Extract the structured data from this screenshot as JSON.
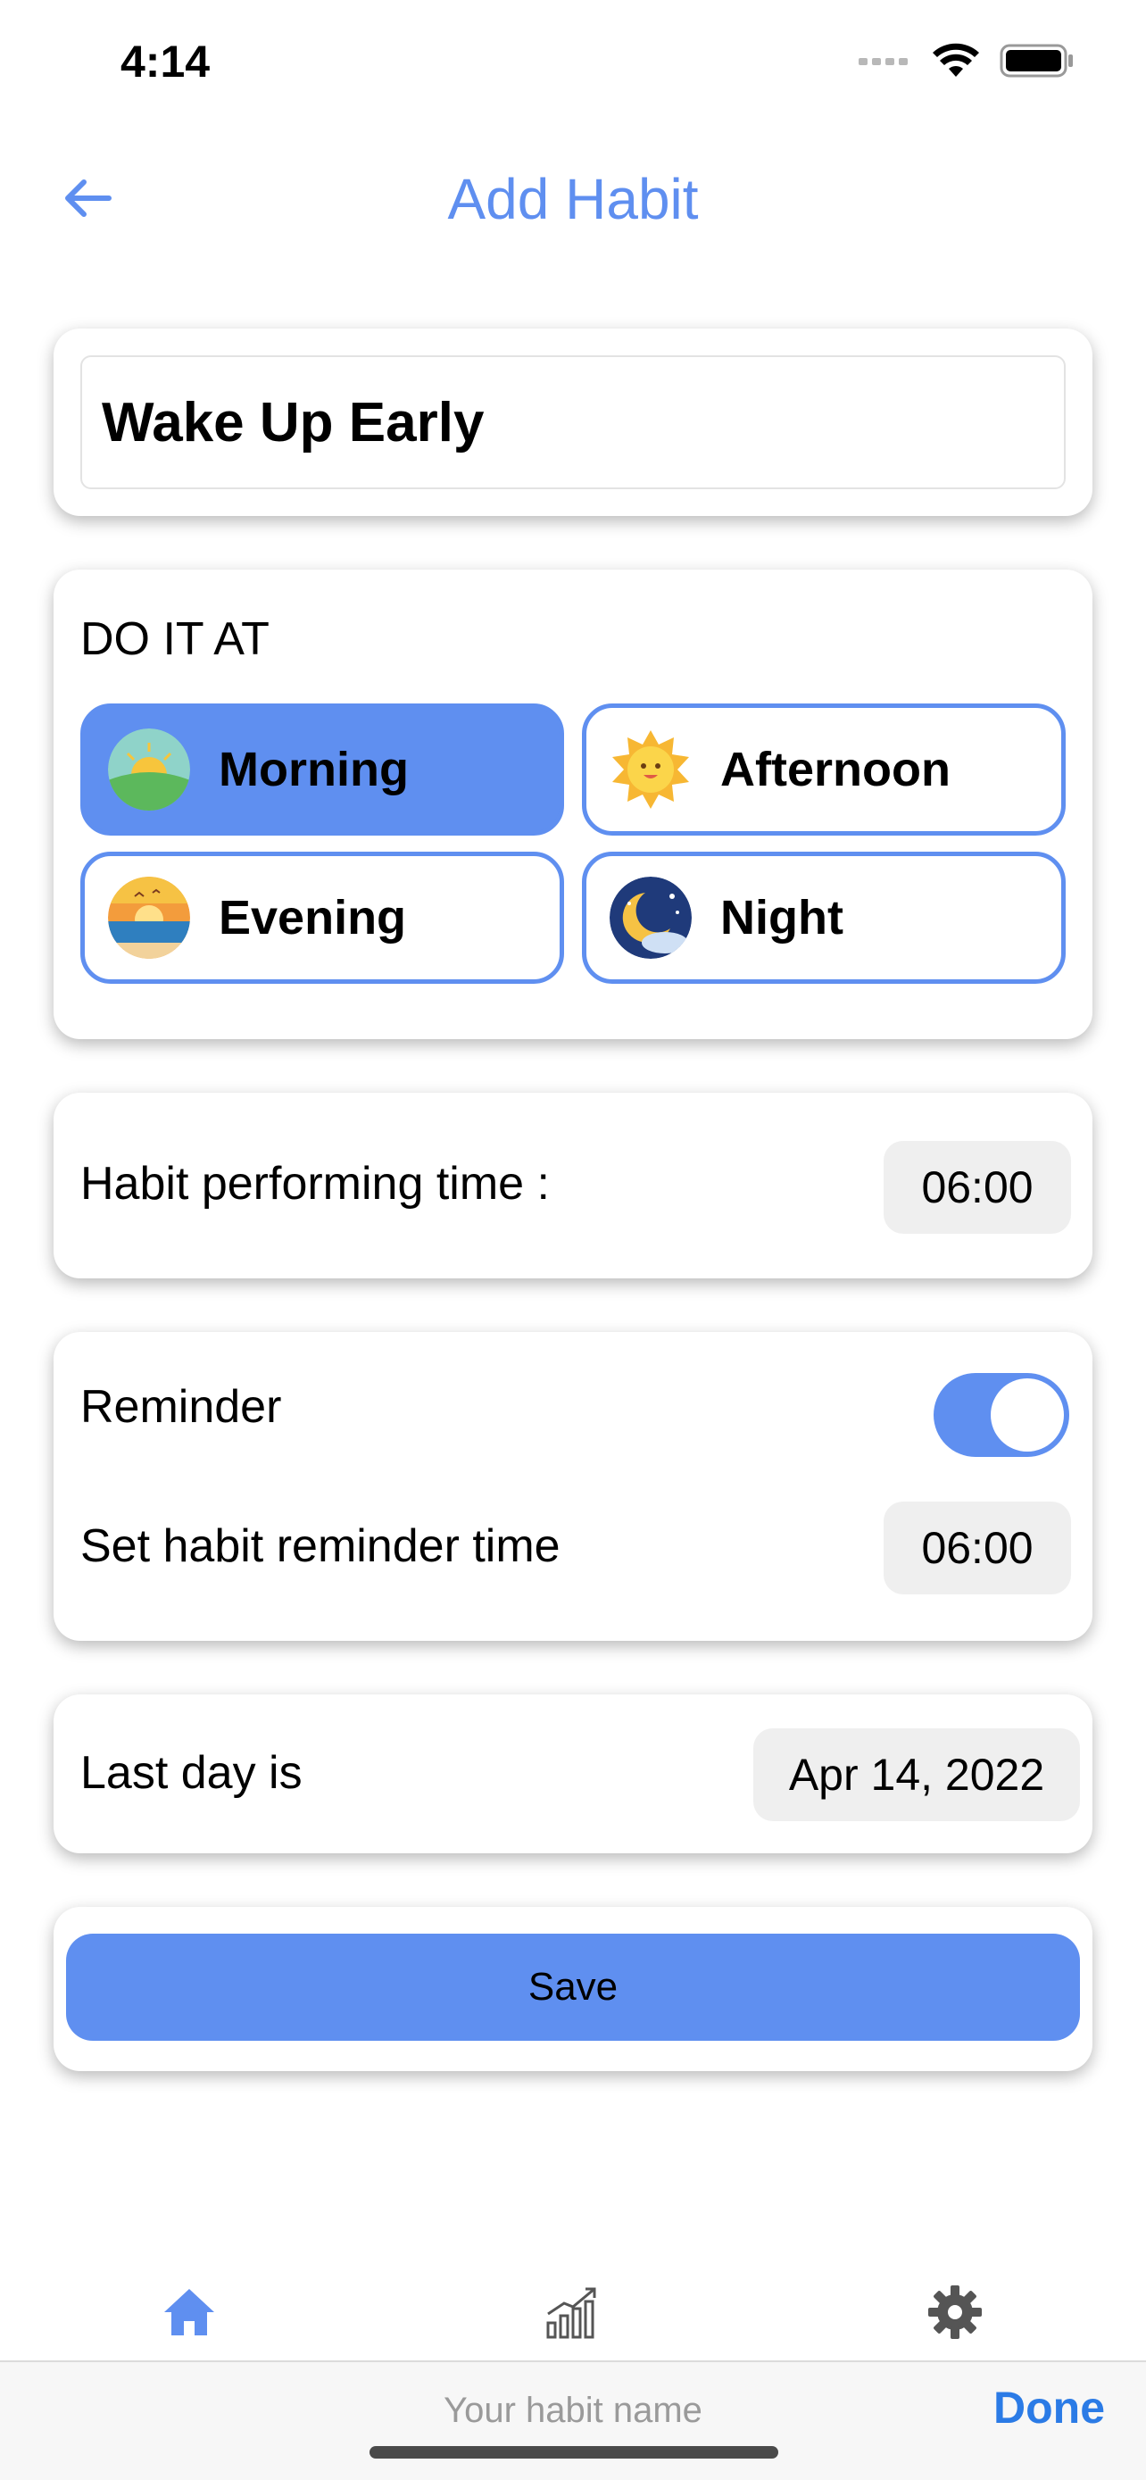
{
  "status_bar": {
    "time": "4:14"
  },
  "header": {
    "title": "Add Habit"
  },
  "habit_name": {
    "value": "Wake Up Early"
  },
  "do_it_at": {
    "label": "DO IT AT",
    "selected": "Morning",
    "options": [
      {
        "label": "Morning",
        "icon": "sunrise-icon"
      },
      {
        "label": "Afternoon",
        "icon": "sun-icon"
      },
      {
        "label": "Evening",
        "icon": "sunset-icon"
      },
      {
        "label": "Night",
        "icon": "moon-icon"
      }
    ]
  },
  "performing_time": {
    "label": "Habit performing time :",
    "value": "06:00"
  },
  "reminder": {
    "label": "Reminder",
    "enabled": true,
    "time_label": "Set habit reminder time",
    "time_value": "06:00"
  },
  "last_day": {
    "label": "Last day is",
    "value": "Apr 14, 2022"
  },
  "save": {
    "label": "Save"
  },
  "tab_bar": {
    "items": [
      {
        "icon": "home-icon",
        "active": true
      },
      {
        "icon": "chart-icon"
      },
      {
        "icon": "gear-icon"
      }
    ]
  },
  "keyboard_accessory": {
    "placeholder": "Your habit name",
    "done_label": "Done"
  },
  "colors": {
    "accent": "#5f8ff0",
    "done": "#2b7be6"
  }
}
